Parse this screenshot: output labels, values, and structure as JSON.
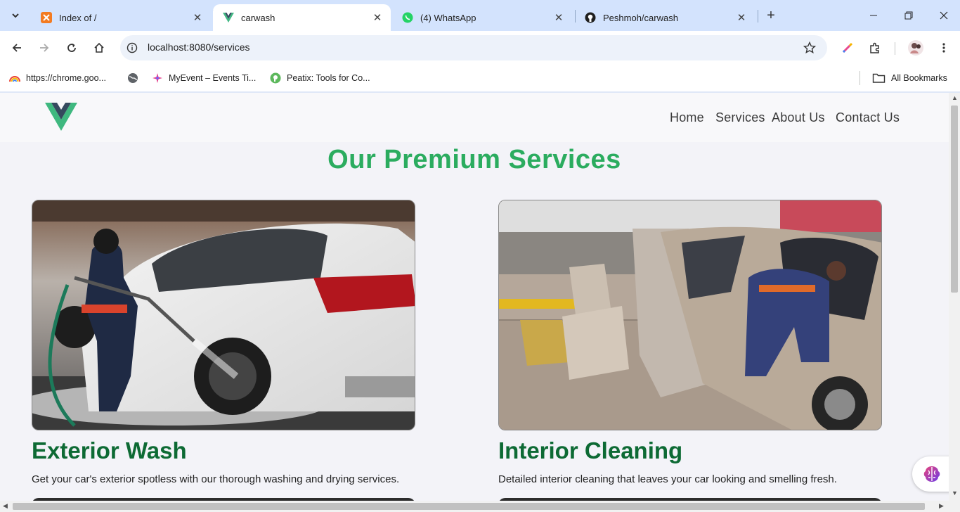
{
  "browser": {
    "tabs": [
      {
        "title": "Index of /",
        "active": false
      },
      {
        "title": "carwash",
        "active": true
      },
      {
        "title": "(4) WhatsApp",
        "active": false
      },
      {
        "title": "Peshmoh/carwash",
        "active": false
      }
    ],
    "url": "localhost:8080/services",
    "bookmarks": [
      {
        "label": "https://chrome.goo..."
      },
      {
        "label": ""
      },
      {
        "label": "MyEvent – Events Ti..."
      },
      {
        "label": "Peatix: Tools for Co..."
      }
    ],
    "all_bookmarks_label": "All Bookmarks"
  },
  "site": {
    "nav": [
      "Home",
      "Services",
      "About Us",
      "Contact Us"
    ],
    "heading": "Our Premium Services",
    "services": [
      {
        "title": "Exterior Wash",
        "description": "Get your car's exterior spotless with our thorough washing and drying services."
      },
      {
        "title": "Interior Cleaning",
        "description": "Detailed interior cleaning that leaves your car looking and smelling fresh."
      }
    ]
  },
  "colors": {
    "accent": "#2bac5f",
    "card_title": "#0d6a34",
    "tab_strip": "#d3e3fd"
  },
  "icons": [
    "xampp-icon",
    "vue-icon",
    "whatsapp-icon",
    "github-icon",
    "back-icon",
    "forward-icon",
    "reload-icon",
    "home-icon",
    "info-icon",
    "star-icon",
    "pen-icon",
    "puzzle-icon",
    "avatar",
    "menu-icon",
    "folder-icon",
    "brain-icon"
  ]
}
